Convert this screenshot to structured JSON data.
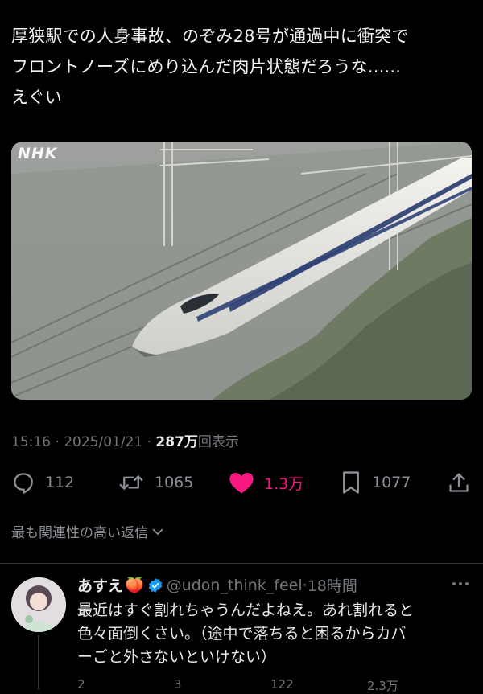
{
  "post": {
    "text_line1": "厚狭駅での人身事故、のぞみ28号が通過中に衝突で",
    "text_line2": "フロントノーズにめり込んだ肉片状態だろうな......",
    "text_line3": "えぐい",
    "media_watermark": "NHK",
    "time": "15:16",
    "date": "2025/01/21",
    "separator": "·",
    "views_count": "287万",
    "views_label": "回表示"
  },
  "actions": {
    "reply_count": "112",
    "retweet_count": "1065",
    "like_count": "1.3万",
    "bookmark_count": "1077"
  },
  "colors": {
    "like": "#f91880",
    "verified": "#1d9bf0",
    "muted": "#71767b"
  },
  "replies_sort": {
    "label": "最も関連性の高い返信"
  },
  "reply": {
    "name": "あすえ",
    "name_emoji": "🍑",
    "handle": "@udon_think_feel",
    "separator": "·",
    "time": "18時間",
    "text_line1": "最近はすぐ割れちゃうんだよねえ。あれ割れると",
    "text_line2": "色々面倒くさい。（途中で落ちると困るからカバ",
    "text_line3": "ーごと外さないといけない）",
    "reply_count": "2",
    "retweet_count": "3",
    "like_count": "122",
    "views_count": "2.3万"
  },
  "icons": [
    "reply-icon",
    "retweet-icon",
    "heart-icon",
    "bookmark-icon",
    "share-icon",
    "chevron-down-icon",
    "verified-badge-icon",
    "more-icon"
  ]
}
